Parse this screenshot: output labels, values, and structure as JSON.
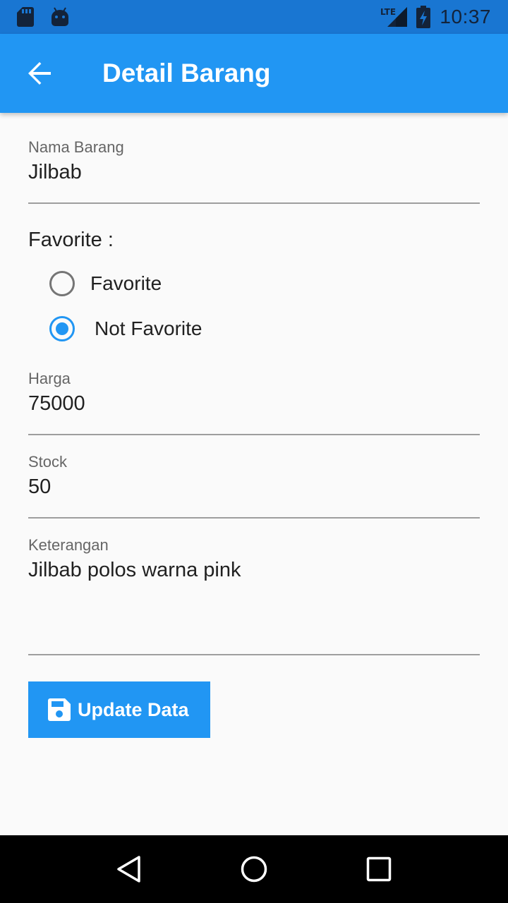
{
  "status_bar": {
    "time": "10:37",
    "network": "LTE",
    "icons": [
      "sd-card-icon",
      "android-icon",
      "lte-signal-icon",
      "battery-charging-icon"
    ]
  },
  "app_bar": {
    "title": "Detail Barang",
    "back_icon": "arrow-back-icon",
    "background": "#2196f3"
  },
  "form": {
    "nama_barang": {
      "label": "Nama Barang",
      "value": "Jilbab"
    },
    "favorite": {
      "label": "Favorite :",
      "options": [
        {
          "label": "Favorite",
          "checked": false
        },
        {
          "label": "Not Favorite",
          "checked": true
        }
      ]
    },
    "harga": {
      "label": "Harga",
      "value": "75000"
    },
    "stock": {
      "label": "Stock",
      "value": "50"
    },
    "keterangan": {
      "label": "Keterangan",
      "value": "Jilbab polos warna pink"
    }
  },
  "update_button": {
    "label": "Update Data",
    "icon": "save-icon"
  },
  "nav_bar": {
    "icons": [
      "back-triangle-icon",
      "home-circle-icon",
      "recents-square-icon"
    ]
  },
  "colors": {
    "accent": "#2196f3",
    "status_bar": "#1976d2",
    "nav_bar": "#000000"
  }
}
